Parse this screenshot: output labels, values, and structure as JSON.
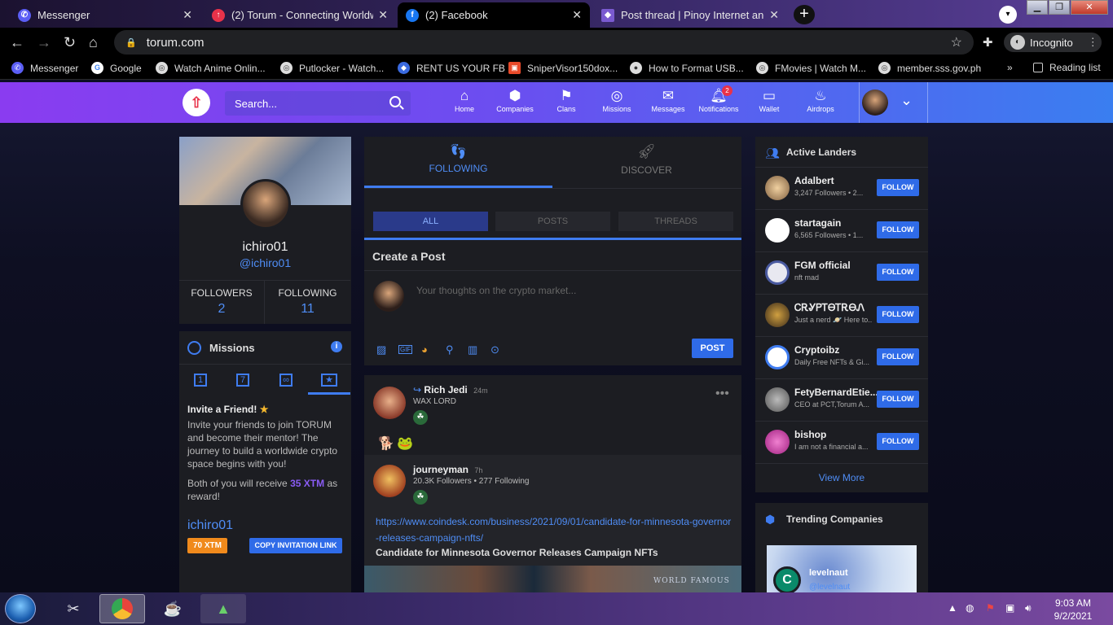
{
  "browser": {
    "tabs": [
      {
        "label": "Messenger",
        "icon": "messenger-icon",
        "color": "#5b5ef5",
        "active": false
      },
      {
        "label": "(2) Torum - Connecting Worldwide",
        "icon": "torum-icon",
        "color": "#e8324a",
        "active": false
      },
      {
        "label": "(2) Facebook",
        "icon": "facebook-icon",
        "color": "#1877f2",
        "active": true
      },
      {
        "label": "Post thread | Pinoy Internet and T",
        "icon": "pinoy-icon",
        "color": "#c04040",
        "active": false
      }
    ],
    "url": "torum.com",
    "incognito_label": "Incognito",
    "bookmarks": [
      {
        "label": "Messenger",
        "icon": "messenger-icon"
      },
      {
        "label": "Google",
        "icon": "google-icon"
      },
      {
        "label": "Watch Anime Onlin...",
        "icon": "globe-icon"
      },
      {
        "label": "Putlocker - Watch...",
        "icon": "globe-icon"
      },
      {
        "label": "RENT US YOUR FB",
        "icon": "rent-icon"
      },
      {
        "label": "SniperVisor150dox...",
        "icon": "bag-icon"
      },
      {
        "label": "How to Format USB...",
        "icon": "circle-icon"
      },
      {
        "label": "FMovies | Watch M...",
        "icon": "globe-icon"
      },
      {
        "label": "member.sss.gov.ph",
        "icon": "globe-icon"
      }
    ],
    "reading_list": "Reading list"
  },
  "site": {
    "search_placeholder": "Search...",
    "nav": [
      {
        "label": "Home",
        "icon": "home-icon"
      },
      {
        "label": "Companies",
        "icon": "cube-icon"
      },
      {
        "label": "Clans",
        "icon": "flag-icon"
      },
      {
        "label": "Missions",
        "icon": "target-icon"
      },
      {
        "label": "Messages",
        "icon": "mail-icon"
      },
      {
        "label": "Notifications",
        "icon": "bell-icon",
        "badge": "2"
      },
      {
        "label": "Wallet",
        "icon": "wallet-icon"
      },
      {
        "label": "Airdrops",
        "icon": "fire-icon"
      }
    ]
  },
  "profile": {
    "name": "ichiro01",
    "handle": "@ichiro01",
    "followers_label": "FOLLOWERS",
    "followers": "2",
    "following_label": "FOLLOWING",
    "following": "11"
  },
  "missions": {
    "title": "Missions",
    "tabs": [
      "1",
      "7",
      "∞",
      "★"
    ],
    "heading": "Invite a Friend!",
    "body": "Invite your friends to join TORUM and become their mentor! The journey to build a worldwide crypto space begins with you!",
    "reward_prefix": "Both of you will receive",
    "reward_amount": "35 XTM",
    "reward_suffix": "as reward!",
    "username": "ichiro01",
    "xtm_badge": "70 XTM",
    "copy_button": "COPY INVITATION LINK"
  },
  "feed": {
    "tab_following": "FOLLOWING",
    "tab_discover": "DISCOVER",
    "filters": [
      "ALL",
      "POSTS",
      "THREADS"
    ],
    "create_title": "Create a Post",
    "create_placeholder": "Your thoughts on the crypto market...",
    "post_button": "POST",
    "post": {
      "author": "Rich Jedi",
      "time": "24m",
      "subtitle": "WAX LORD",
      "shared": {
        "author": "journeyman",
        "time": "7h",
        "followers": "20.3K Followers",
        "following": "277 Following",
        "link": "https://www.coindesk.com/business/2021/09/01/candidate-for-minnesota-governor-releases-campaign-nfts/",
        "headline": "Candidate for Minnesota Governor Releases Campaign NFTs",
        "image_text": "WORLD FAMOUS"
      }
    }
  },
  "landers": {
    "title": "Active Landers",
    "follow_label": "FOLLOW",
    "items": [
      {
        "name": "Adalbert",
        "sub": "3,247 Followers • 2...",
        "color": "#c8a070"
      },
      {
        "name": "startagain",
        "sub": "6,565 Followers • 1...",
        "color": "#ffffff"
      },
      {
        "name": "FGM official",
        "sub": "nft mad",
        "color": "#e8e8f0"
      },
      {
        "name": "ᏟᎡᎽᏢᎢᎾᎢᎡᎾᏁ",
        "sub": "Just a nerd 🪐 Here to...",
        "color": "#6a5040"
      },
      {
        "name": "Cryptoibz",
        "sub": "Daily Free NFTs & Gi...",
        "color": "#ffffff"
      },
      {
        "name": "FetyBernardEtie...",
        "sub": "CEO at PCT,Torum A...",
        "color": "#8a8a8a"
      },
      {
        "name": "bishop",
        "sub": "I am not a financial a...",
        "color": "#e060c0"
      }
    ],
    "view_more": "View More"
  },
  "trending": {
    "title": "Trending Companies",
    "company": "levelnaut",
    "company_handle": "@levelnaut"
  },
  "taskbar": {
    "time": "9:03 AM",
    "date": "9/2/2021"
  }
}
